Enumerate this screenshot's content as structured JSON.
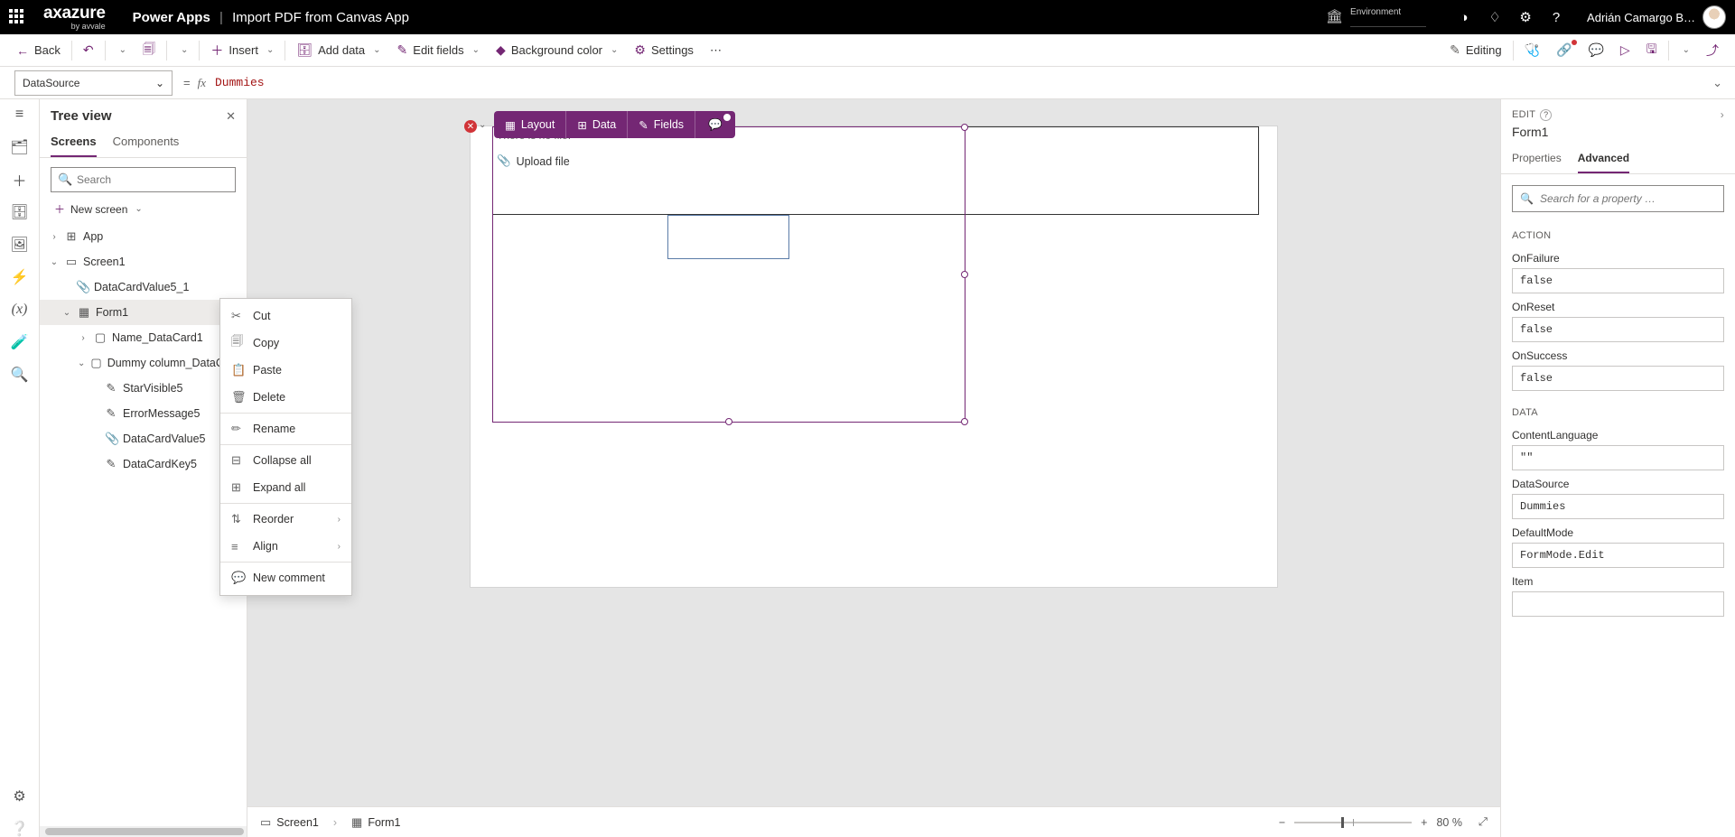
{
  "header": {
    "brand_line1": "axazure",
    "brand_line2": "by avvale",
    "app": "Power Apps",
    "title": "Import PDF from Canvas App",
    "env_label": "Environment",
    "user": "Adrián Camargo B…"
  },
  "cmd": {
    "back": "Back",
    "insert": "Insert",
    "add_data": "Add data",
    "edit_fields": "Edit fields",
    "bg": "Background color",
    "settings": "Settings",
    "editing": "Editing"
  },
  "fbar": {
    "prop": "DataSource",
    "formula": "Dummies"
  },
  "tree": {
    "title": "Tree view",
    "tab_screens": "Screens",
    "tab_components": "Components",
    "search_ph": "Search",
    "new_screen": "New screen",
    "items": {
      "app": "App",
      "screen1": "Screen1",
      "dcv51": "DataCardValue5_1",
      "form1": "Form1",
      "name_dc": "Name_DataCard1",
      "dummy_dc": "Dummy column_DataCard4",
      "star": "StarVisible5",
      "err": "ErrorMessage5",
      "dcv5": "DataCardValue5",
      "dck5": "DataCardKey5"
    }
  },
  "ctx": {
    "cut": "Cut",
    "copy": "Copy",
    "paste": "Paste",
    "delete": "Delete",
    "rename": "Rename",
    "collapse": "Collapse all",
    "expand": "Expand all",
    "reorder": "Reorder",
    "align": "Align",
    "comment": "New comment"
  },
  "canvas": {
    "pill": {
      "layout": "Layout",
      "data": "Data",
      "fields": "Fields"
    },
    "nofile": "There is no file.",
    "upload": "Upload file"
  },
  "crumbs": {
    "screen1": "Screen1",
    "form1": "Form1"
  },
  "zoom": {
    "pct": "80  %"
  },
  "props": {
    "edit_label": "EDIT",
    "name": "Form1",
    "tab_props": "Properties",
    "tab_adv": "Advanced",
    "search_ph": "Search for a property …",
    "sec_action": "ACTION",
    "sec_data": "DATA",
    "fields": {
      "OnFailure": "false",
      "OnReset": "false",
      "OnSuccess": "false",
      "ContentLanguage": "\"\"",
      "DataSource": "Dummies",
      "DefaultMode": "FormMode.Edit",
      "Item": ""
    }
  }
}
